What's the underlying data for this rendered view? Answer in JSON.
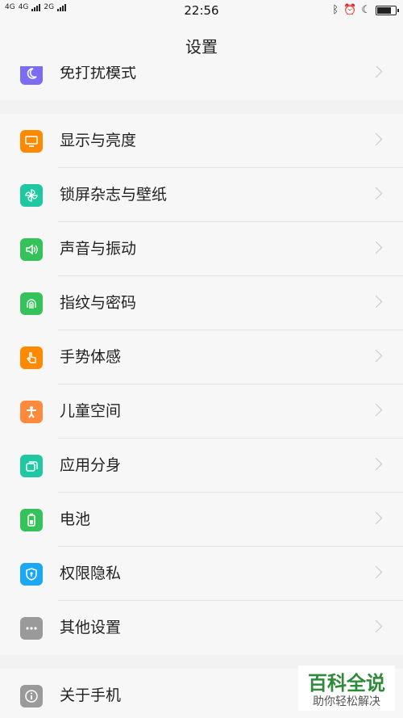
{
  "status": {
    "network1": "4G",
    "network1b": "4G",
    "network2": "2G",
    "time": "22:56",
    "battery_level": 0.7
  },
  "header": {
    "title": "设置"
  },
  "groups": [
    {
      "items": [
        {
          "label": "免打扰模式",
          "icon": "moon-icon",
          "color": "#7c6cf2"
        }
      ]
    },
    {
      "items": [
        {
          "label": "显示与亮度",
          "icon": "monitor-icon",
          "color": "#ff8a00"
        },
        {
          "label": "锁屏杂志与壁纸",
          "icon": "pinwheel-icon",
          "color": "#1fc8a0"
        },
        {
          "label": "声音与振动",
          "icon": "speaker-icon",
          "color": "#35c25a"
        },
        {
          "label": "指纹与密码",
          "icon": "fingerprint-icon",
          "color": "#35c25a"
        },
        {
          "label": "手势体感",
          "icon": "hand-gesture-icon",
          "color": "#ff8a00"
        },
        {
          "label": "儿童空间",
          "icon": "child-icon",
          "color": "#ff8a3d"
        },
        {
          "label": "应用分身",
          "icon": "app-clone-icon",
          "color": "#1fc8a0"
        },
        {
          "label": "电池",
          "icon": "battery-icon",
          "color": "#35c25a"
        },
        {
          "label": "权限隐私",
          "icon": "shield-icon",
          "color": "#1aa8f5"
        },
        {
          "label": "其他设置",
          "icon": "more-dots-icon",
          "color": "#9a9a9a"
        }
      ]
    },
    {
      "items": [
        {
          "label": "关于手机",
          "icon": "info-icon",
          "color": "#9a9a9a"
        }
      ]
    }
  ],
  "watermark": {
    "main": "百科全说",
    "sub": "助你轻松解决"
  }
}
